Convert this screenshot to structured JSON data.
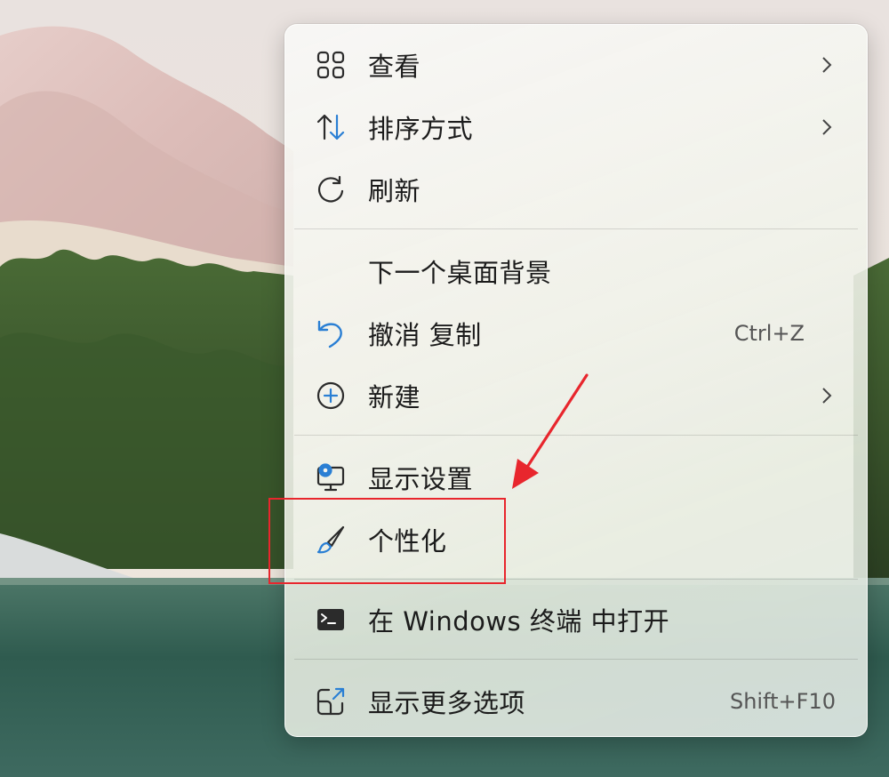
{
  "menu": {
    "items": [
      {
        "id": "view",
        "label": "查看",
        "icon": "grid-icon",
        "has_submenu": true,
        "shortcut": ""
      },
      {
        "id": "sort",
        "label": "排序方式",
        "icon": "sort-arrows-icon",
        "has_submenu": true,
        "shortcut": ""
      },
      {
        "id": "refresh",
        "label": "刷新",
        "icon": "refresh-icon",
        "has_submenu": false,
        "shortcut": ""
      },
      {
        "id": "next-bg",
        "label": "下一个桌面背景",
        "icon": "",
        "has_submenu": false,
        "shortcut": ""
      },
      {
        "id": "undo",
        "label": "撤消 复制",
        "icon": "undo-icon",
        "has_submenu": false,
        "shortcut": "Ctrl+Z"
      },
      {
        "id": "new",
        "label": "新建",
        "icon": "plus-circle-icon",
        "has_submenu": true,
        "shortcut": ""
      },
      {
        "id": "display",
        "label": "显示设置",
        "icon": "display-settings-icon",
        "has_submenu": false,
        "shortcut": ""
      },
      {
        "id": "personalize",
        "label": "个性化",
        "icon": "paintbrush-icon",
        "has_submenu": false,
        "shortcut": ""
      },
      {
        "id": "terminal",
        "label": "在 Windows 终端 中打开",
        "icon": "terminal-icon",
        "has_submenu": false,
        "shortcut": ""
      },
      {
        "id": "more",
        "label": "显示更多选项",
        "icon": "share-expand-icon",
        "has_submenu": false,
        "shortcut": "Shift+F10"
      }
    ]
  },
  "annotation": {
    "highlight_color": "#e8262d",
    "highlight_target": "personalize"
  },
  "colors": {
    "accent_blue": "#2a7fd4",
    "icon_gray": "#2b2b2b"
  }
}
